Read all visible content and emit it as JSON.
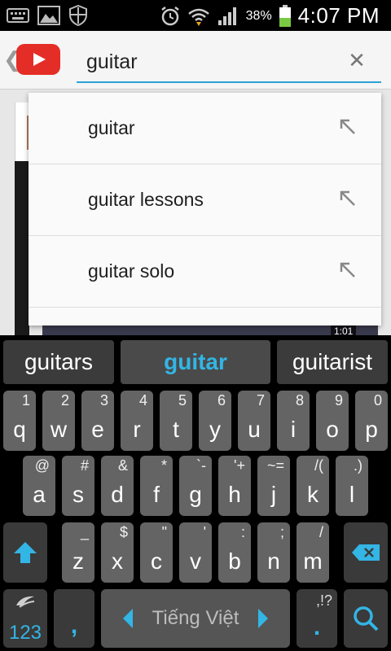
{
  "status_bar": {
    "battery_percent": "38%",
    "time": "4:07 PM",
    "icons": [
      "keyboard-icon",
      "image-icon",
      "shield-icon",
      "alarm-icon",
      "wifi-icon",
      "signal-icon",
      "battery-icon"
    ]
  },
  "action_bar": {
    "search_value": "guitar",
    "clear_icon": "close-icon",
    "logo": "youtube-logo"
  },
  "suggestions": [
    {
      "label": "guitar"
    },
    {
      "label": "guitar lessons"
    },
    {
      "label": "guitar solo"
    }
  ],
  "background": {
    "video_duration": "1:01"
  },
  "keyboard": {
    "suggestion_bar": [
      "guitars",
      "guitar",
      "guitarist"
    ],
    "row1": [
      {
        "main": "q",
        "sub": "1"
      },
      {
        "main": "w",
        "sub": "2"
      },
      {
        "main": "e",
        "sub": "3"
      },
      {
        "main": "r",
        "sub": "4"
      },
      {
        "main": "t",
        "sub": "5"
      },
      {
        "main": "y",
        "sub": "6"
      },
      {
        "main": "u",
        "sub": "7"
      },
      {
        "main": "i",
        "sub": "8"
      },
      {
        "main": "o",
        "sub": "9"
      },
      {
        "main": "p",
        "sub": "0"
      }
    ],
    "row2": [
      {
        "main": "a",
        "sub": "@"
      },
      {
        "main": "s",
        "sub": "#"
      },
      {
        "main": "d",
        "sub": "&"
      },
      {
        "main": "f",
        "sub": "*"
      },
      {
        "main": "g",
        "sub": "`-"
      },
      {
        "main": "h",
        "sub": "'+"
      },
      {
        "main": "j",
        "sub": "~="
      },
      {
        "main": "k",
        "sub": "/("
      },
      {
        "main": "l",
        "sub": ".)"
      }
    ],
    "row3": [
      {
        "main": "z",
        "sub": "_"
      },
      {
        "main": "x",
        "sub": "$"
      },
      {
        "main": "c",
        "sub": "\""
      },
      {
        "main": "v",
        "sub": "'"
      },
      {
        "main": "b",
        "sub": ":"
      },
      {
        "main": "n",
        "sub": ";"
      },
      {
        "main": "m",
        "sub": "/"
      }
    ],
    "numbers_label": "123",
    "comma_label": ",",
    "language_label": "Tiếng Việt",
    "period_label": ".",
    "period_sub": ",!?",
    "accent_color": "#33b5e5"
  }
}
